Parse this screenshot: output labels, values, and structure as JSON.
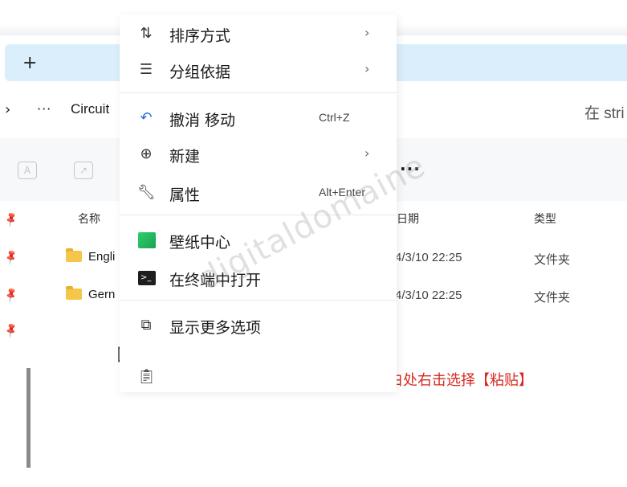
{
  "explorer": {
    "new_tab_symbol": "+",
    "breadcrumb_chevron": "›",
    "breadcrumb_more": "···",
    "breadcrumb_folder": "Circuit",
    "search_placeholder_fragment": "在 stri",
    "toolbar_more": "···",
    "columns": {
      "name": "名称",
      "date": "日期",
      "type": "类型"
    },
    "rows": [
      {
        "name": "Engli",
        "date": "4/3/10 22:25",
        "type": "文件夹"
      },
      {
        "name": "Gern",
        "date": "4/3/10 22:25",
        "type": "文件夹"
      }
    ]
  },
  "context_menu": {
    "items": [
      {
        "label": "排序方式",
        "icon": "sort-icon",
        "has_submenu": true
      },
      {
        "label": "分组依据",
        "icon": "group-icon",
        "has_submenu": true
      },
      {
        "label": "撤消 移动",
        "icon": "undo-icon",
        "shortcut": "Ctrl+Z"
      },
      {
        "label": "新建",
        "icon": "new-icon",
        "has_submenu": true
      },
      {
        "label": "属性",
        "icon": "wrench-icon",
        "shortcut": "Alt+Enter"
      },
      {
        "label": "壁纸中心",
        "icon": "wallpaper-icon"
      },
      {
        "label": "在终端中打开",
        "icon": "terminal-icon"
      },
      {
        "label": "显示更多选项",
        "icon": "more-options-icon"
      }
    ],
    "submenu_arrow": "›"
  },
  "annotation": {
    "instruction": "在空白处右击选择【粘贴】"
  },
  "watermark": {
    "text": "digitaldomaine"
  }
}
